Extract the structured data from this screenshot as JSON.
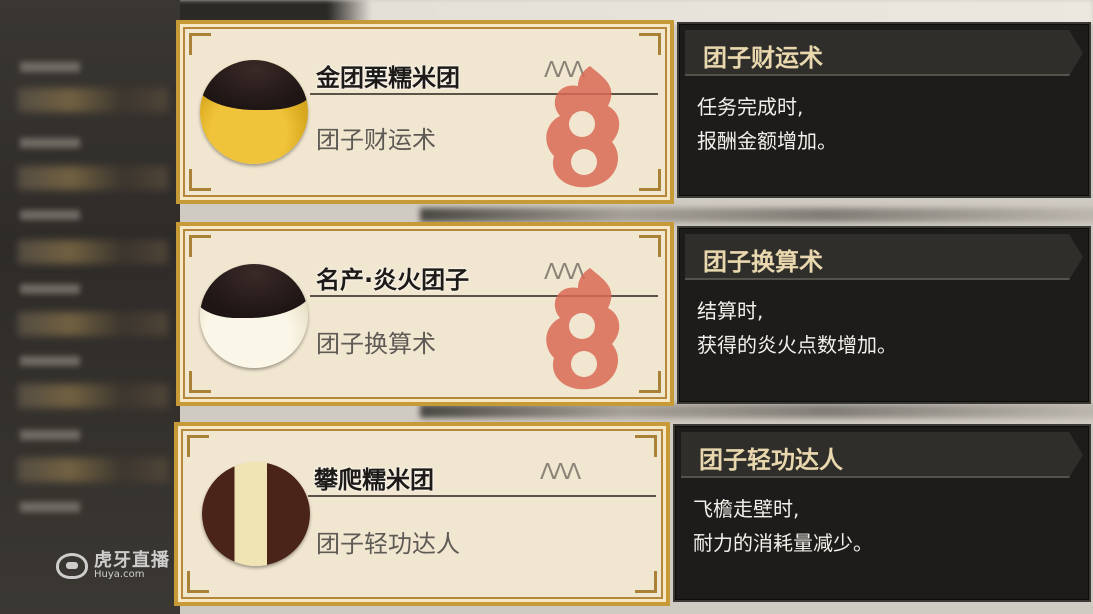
{
  "watermark": {
    "brand_cn": "虎牙直播",
    "brand_en": "Huya.com"
  },
  "items": [
    {
      "name": "金团栗糯米团",
      "skill": "团子财运术",
      "rarity": "ᐱᐱᐱ",
      "description_title": "团子财运术",
      "description_lines": [
        "任务完成时,",
        "报酬金额增加。"
      ]
    },
    {
      "name": "名产·炎火团子",
      "skill": "团子换算术",
      "rarity": "ᐱᐱᐱ",
      "description_title": "团子换算术",
      "description_lines": [
        "结算时,",
        "获得的炎火点数增加。"
      ]
    },
    {
      "name": "攀爬糯米团",
      "skill": "团子轻功达人",
      "rarity": "ᐱᐱᐱ",
      "description_title": "团子轻功达人",
      "description_lines": [
        "飞檐走壁时,",
        "耐力的消耗量减少。"
      ]
    }
  ],
  "colors": {
    "card_border": "#c79a38",
    "card_bg": "#f1e6cf",
    "panel_bg": "#1d1c1a",
    "title_text": "#e9d8ae",
    "emblem_red": "#d96a55"
  }
}
